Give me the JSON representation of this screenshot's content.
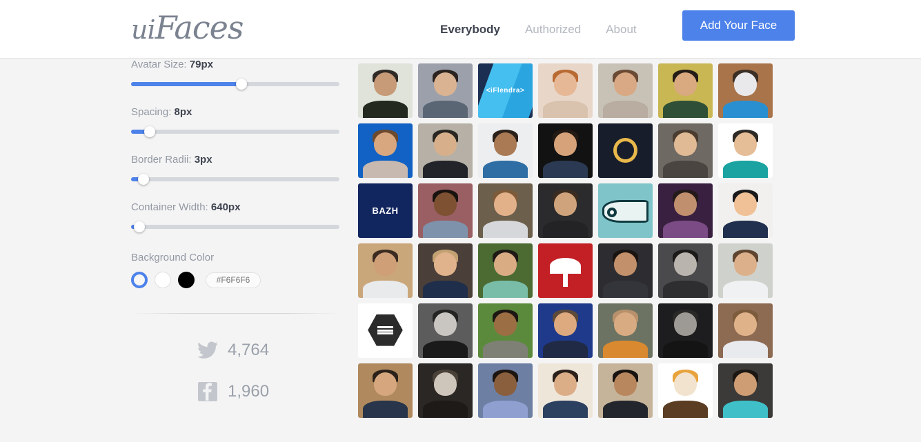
{
  "header": {
    "logo_ui": "ui",
    "logo_faces": "Faces",
    "nav": [
      {
        "label": "Everybody",
        "active": true
      },
      {
        "label": "Authorized",
        "active": false
      },
      {
        "label": "About",
        "active": false
      }
    ],
    "cta_label": "Add Your Face"
  },
  "sidebar": {
    "controls": [
      {
        "label": "Avatar Size: ",
        "value": "79px",
        "fill_pct": 53
      },
      {
        "label": "Spacing: ",
        "value": "8px",
        "fill_pct": 9
      },
      {
        "label": "Border Radii: ",
        "value": "3px",
        "fill_pct": 6
      },
      {
        "label": "Container Width: ",
        "value": "640px",
        "fill_pct": 4
      }
    ],
    "background_color": {
      "label": "Background Color",
      "swatches": [
        {
          "name": "swatch-selected",
          "color": "#F6F6F6",
          "selected": true
        },
        {
          "name": "swatch-white",
          "color": "#FFFFFF",
          "selected": false
        },
        {
          "name": "swatch-black",
          "color": "#000000",
          "selected": false
        }
      ],
      "hex_value": "#F6F6F6",
      "hex_placeholder": "#F6F6F6"
    },
    "social": [
      {
        "icon": "twitter-icon",
        "count": "4,764"
      },
      {
        "icon": "facebook-icon",
        "count": "1,960"
      }
    ]
  },
  "grid": {
    "avatar_size_px": 79,
    "spacing_px": 8,
    "border_radius_px": 3,
    "columns": 7,
    "avatars": [
      {
        "name": "avatar-bearded-sunglasses",
        "kind": "photo",
        "bg": "#dfe3da",
        "skin": "#c79a78",
        "hair": "#2f2a26",
        "shirt": "#23291f"
      },
      {
        "name": "avatar-young-man-suit",
        "kind": "photo",
        "bg": "#9ba0ab",
        "skin": "#d9b392",
        "hair": "#2b2320",
        "shirt": "#5b6675"
      },
      {
        "name": "avatar-iflendra-logo",
        "kind": "text",
        "text": "<iFlendra>",
        "bg": "#1b2f52",
        "stripe1": "#45bef0",
        "stripe2": "#2ba5e0",
        "font_size": 10
      },
      {
        "name": "avatar-excited-face",
        "kind": "photo",
        "bg": "#e8d7c9",
        "skin": "#e6b896",
        "hair": "#b96a32",
        "shirt": "#d9c2ae"
      },
      {
        "name": "avatar-smiling-man-shirt",
        "kind": "photo",
        "bg": "#c8c2b6",
        "skin": "#d8a984",
        "hair": "#6b4a34",
        "shirt": "#b9aca0"
      },
      {
        "name": "avatar-man-green-jacket",
        "kind": "photo",
        "bg": "#c9b754",
        "skin": "#d9a97f",
        "hair": "#241c16",
        "shirt": "#2f5036"
      },
      {
        "name": "avatar-astronaut-helmet",
        "kind": "photo",
        "bg": "#a9744a",
        "skin": "#e9e9ec",
        "hair": "#3c2f26",
        "shirt": "#2a8fd0"
      },
      {
        "name": "avatar-man-blue-backdrop",
        "kind": "photo",
        "bg": "#1162c4",
        "skin": "#d8a780",
        "hair": "#6d4a2e",
        "shirt": "#c8b9b0"
      },
      {
        "name": "avatar-standing-full-body",
        "kind": "photo",
        "bg": "#b6b0a6",
        "skin": "#d7b08b",
        "hair": "#2a2622",
        "shirt": "#22242a"
      },
      {
        "name": "avatar-young-man-tank-top",
        "kind": "photo",
        "bg": "#eceef0",
        "skin": "#a97a54",
        "hair": "#2a211b",
        "shirt": "#2f6ea5"
      },
      {
        "name": "avatar-man-circle-crop",
        "kind": "photo",
        "bg": "#121212",
        "skin": "#d6a279",
        "hair": "#241a14",
        "shirt": "#2b3a52"
      },
      {
        "name": "avatar-laurel-wreath-logo",
        "kind": "wreath",
        "bg": "#181d2b",
        "accent": "#e8b84b"
      },
      {
        "name": "avatar-man-glasses-thinking",
        "kind": "photo",
        "bg": "#6e6963",
        "skin": "#e0b995",
        "hair": "#4b3c30",
        "shirt": "#4a4540"
      },
      {
        "name": "avatar-cartoon-man-teal-shirt",
        "kind": "photo",
        "bg": "#ffffff",
        "skin": "#e5bd96",
        "hair": "#2e2a26",
        "shirt": "#1aa3a0"
      },
      {
        "name": "avatar-bazh-logo",
        "kind": "text",
        "text": "BAZH",
        "bg": "#11255e",
        "font_size": 13
      },
      {
        "name": "avatar-man-arms-crossed",
        "kind": "photo",
        "bg": "#9a5f63",
        "skin": "#7e5133",
        "hair": "#191310",
        "shirt": "#7e93ab"
      },
      {
        "name": "avatar-smiling-man-suit",
        "kind": "photo",
        "bg": "#6c5f4c",
        "skin": "#e2b089",
        "hair": "#7d5b3a",
        "shirt": "#d5d7da"
      },
      {
        "name": "avatar-man-dark-background",
        "kind": "photo",
        "bg": "#2b2b2d",
        "skin": "#cfa47c",
        "hair": "#3b2c21",
        "shirt": "#232326"
      },
      {
        "name": "avatar-fish-illustration",
        "kind": "fish",
        "bg": "#7fc4c8",
        "accent": "#0f3a40"
      },
      {
        "name": "avatar-man-purple-light",
        "kind": "photo",
        "bg": "#3a2040",
        "skin": "#c08f6e",
        "hair": "#241a19",
        "shirt": "#7a4b84"
      },
      {
        "name": "avatar-cartoon-man-white",
        "kind": "photo",
        "bg": "#f2f0ee",
        "skin": "#f0c096",
        "hair": "#1a1a1c",
        "shirt": "#20304e"
      },
      {
        "name": "avatar-man-sunglasses-outdoor",
        "kind": "photo",
        "bg": "#caa77a",
        "skin": "#cf9f77",
        "hair": "#3b2b21",
        "shirt": "#e9eaec"
      },
      {
        "name": "avatar-blond-smiling-man",
        "kind": "photo",
        "bg": "#4b3f3a",
        "skin": "#e0b38c",
        "hair": "#c3a172",
        "shirt": "#1f2e4a"
      },
      {
        "name": "avatar-man-sunglasses-forest",
        "kind": "photo",
        "bg": "#4b6b33",
        "skin": "#d9ac84",
        "hair": "#1f1a16",
        "shirt": "#79bda8"
      },
      {
        "name": "avatar-umbrella-logo",
        "kind": "umbrella",
        "bg": "#c32026"
      },
      {
        "name": "avatar-man-dark-suit",
        "kind": "photo",
        "bg": "#2d2d31",
        "skin": "#c2906a",
        "hair": "#1b1512",
        "shirt": "#34353a"
      },
      {
        "name": "avatar-bw-portrait-curly",
        "kind": "photo",
        "bg": "#4a4a4c",
        "skin": "#b9b4ae",
        "hair": "#1d1b1a",
        "shirt": "#2e2e30"
      },
      {
        "name": "avatar-man-lab-coat",
        "kind": "photo",
        "bg": "#cfd2cc",
        "skin": "#dcb08b",
        "hair": "#5f4530",
        "shirt": "#f0f1f2"
      },
      {
        "name": "avatar-hexagon-logo",
        "kind": "hexagon",
        "bg": "#ffffff"
      },
      {
        "name": "avatar-bw-laughing-man",
        "kind": "photo",
        "bg": "#5c5c5c",
        "skin": "#c9c6c2",
        "hair": "#242423",
        "shirt": "#1a1a1a"
      },
      {
        "name": "avatar-man-glasses-green",
        "kind": "photo",
        "bg": "#5c8a3c",
        "skin": "#9c6e44",
        "hair": "#1d1713",
        "shirt": "#7e8076"
      },
      {
        "name": "avatar-man-blue-cap",
        "kind": "photo",
        "bg": "#1f3a8a",
        "skin": "#dda97f",
        "hair": "#5e4a39",
        "shirt": "#202a44"
      },
      {
        "name": "avatar-bald-man-outdoor",
        "kind": "photo",
        "bg": "#6d7362",
        "skin": "#d9ab82",
        "hair": "#b8916c",
        "shirt": "#d9892f"
      },
      {
        "name": "avatar-bw-man-dark",
        "kind": "photo",
        "bg": "#1d1d1f",
        "skin": "#9d9a96",
        "hair": "#2a2826",
        "shirt": "#141414"
      },
      {
        "name": "avatar-man-white-shirt-street",
        "kind": "photo",
        "bg": "#8d6a52",
        "skin": "#e0b28a",
        "hair": "#7d5c3c",
        "shirt": "#e8eaee"
      },
      {
        "name": "avatar-man-wood-background",
        "kind": "photo",
        "bg": "#b08a5e",
        "skin": "#d6a77e",
        "hair": "#2b211a",
        "shirt": "#28354a"
      },
      {
        "name": "avatar-bw-bearded-glasses",
        "kind": "photo",
        "bg": "#2a2724",
        "skin": "#cfc6bb",
        "hair": "#4a4239",
        "shirt": "#1d1a17"
      },
      {
        "name": "avatar-two-men-thinking",
        "kind": "photo",
        "bg": "#6d7fa3",
        "skin": "#8a5f3e",
        "hair": "#1d1510",
        "shirt": "#8f9fd0"
      },
      {
        "name": "avatar-woman-antlers",
        "kind": "photo",
        "bg": "#efe6da",
        "skin": "#dcae88",
        "hair": "#2b201a",
        "shirt": "#2c4060"
      },
      {
        "name": "avatar-young-man-smiling-wall",
        "kind": "photo",
        "bg": "#c6b49a",
        "skin": "#b9875d",
        "hair": "#181310",
        "shirt": "#23262c"
      },
      {
        "name": "avatar-donald-duck-cartoon",
        "kind": "photo",
        "bg": "#ffffff",
        "skin": "#f2e3cf",
        "hair": "#e8a33d",
        "shirt": "#5a3d22"
      },
      {
        "name": "avatar-man-teal-shirt",
        "kind": "photo",
        "bg": "#3b3a38",
        "skin": "#cf9d74",
        "hair": "#1d1713",
        "shirt": "#3fc0c8"
      }
    ]
  }
}
